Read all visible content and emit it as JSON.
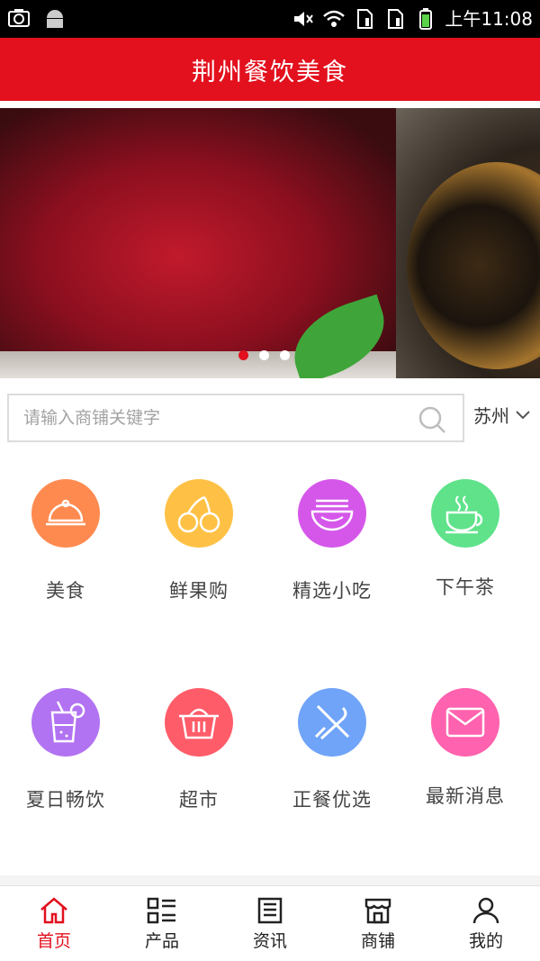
{
  "status_bar": {
    "time": "上午11:08"
  },
  "header": {
    "title": "荆州餐饮美食"
  },
  "banner": {
    "slide_count": 3,
    "active_index": 0
  },
  "search": {
    "placeholder": "请输入商铺关键字",
    "value": ""
  },
  "city": {
    "selected": "苏州"
  },
  "categories": [
    {
      "label": "美食",
      "icon": "cloche-icon",
      "color": "#ff8a50"
    },
    {
      "label": "鲜果购",
      "icon": "cherry-icon",
      "color": "#ffc145"
    },
    {
      "label": "精选小吃",
      "icon": "noodle-bowl-icon",
      "color": "#d557ea"
    },
    {
      "label": "下午茶",
      "icon": "teacup-icon",
      "color": "#5fe28a"
    },
    {
      "label": "夏日畅饮",
      "icon": "drink-icon",
      "color": "#b273f2"
    },
    {
      "label": "超市",
      "icon": "basket-icon",
      "color": "#ff5c6a"
    },
    {
      "label": "正餐优选",
      "icon": "fork-knife-icon",
      "color": "#6fa4f8"
    },
    {
      "label": "最新消息",
      "icon": "mail-icon",
      "color": "#ff62ae"
    }
  ],
  "bottom_nav": [
    {
      "label": "首页",
      "icon": "home-icon",
      "active": true
    },
    {
      "label": "产品",
      "icon": "grid-list-icon",
      "active": false
    },
    {
      "label": "资讯",
      "icon": "news-icon",
      "active": false
    },
    {
      "label": "商铺",
      "icon": "store-icon",
      "active": false
    },
    {
      "label": "我的",
      "icon": "user-icon",
      "active": false
    }
  ],
  "colors": {
    "accent": "#e3101e"
  }
}
